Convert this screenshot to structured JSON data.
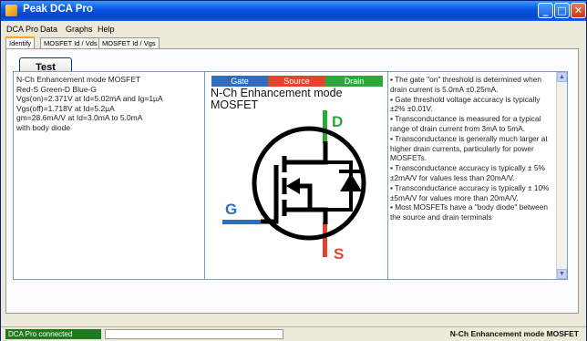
{
  "window": {
    "title": "Peak DCA Pro"
  },
  "menu": [
    "DCA Pro",
    "Data",
    "Graphs",
    "Help"
  ],
  "tabs": [
    "Identify",
    "MOSFET Id / Vds",
    "MOSFET Id / Vgs"
  ],
  "active_tab": "Identify",
  "test_button": "Test",
  "left_info": [
    "N-Ch Enhancement mode MOSFET",
    "Red-S Green-D Blue-G",
    "Vgs(on)=2.371V at Id=5.02mA and Ig=1µA",
    "Vgs(off)=1.718V at Id=5.2µA",
    "gm=28.6mA/V at Id=3.0mA to 5.0mA",
    "with body diode"
  ],
  "diagram": {
    "legend": {
      "gate": "Gate",
      "source": "Source",
      "drain": "Drain"
    },
    "title_line1": "N-Ch Enhancement mode",
    "title_line2": "MOSFET",
    "label_d": "D",
    "label_g": "G",
    "label_s": "S",
    "colors": {
      "gate": "#2f6dbc",
      "source": "#e2452d",
      "drain": "#2ca83a"
    }
  },
  "notes": [
    "▪ The gate \"on\" threshold is determined when drain current is 5.0mA ±0.25mA.",
    "▪ Gate threshold voltage accuracy is typically ±2% ±0.01V.",
    "▪ Transconductance is measured for a typical range of drain current from 3mA to 5mA.",
    "▪ Transconductance is generally much larger at higher drain currents, particularly for power MOSFETs.",
    "▪ Transconductance accuracy is typically ± 5% ±2mA/V for values less than 20mA/V.",
    "▪ Transconductance accuracy is typically ± 10% ±5mA/V for values more than 20mA/V.",
    "▪ Most MOSFETs have a \"body diode\" between the source and drain terminals"
  ],
  "status": {
    "connection": "DCA Pro connected",
    "device": "N-Ch Enhancement mode MOSFET"
  }
}
